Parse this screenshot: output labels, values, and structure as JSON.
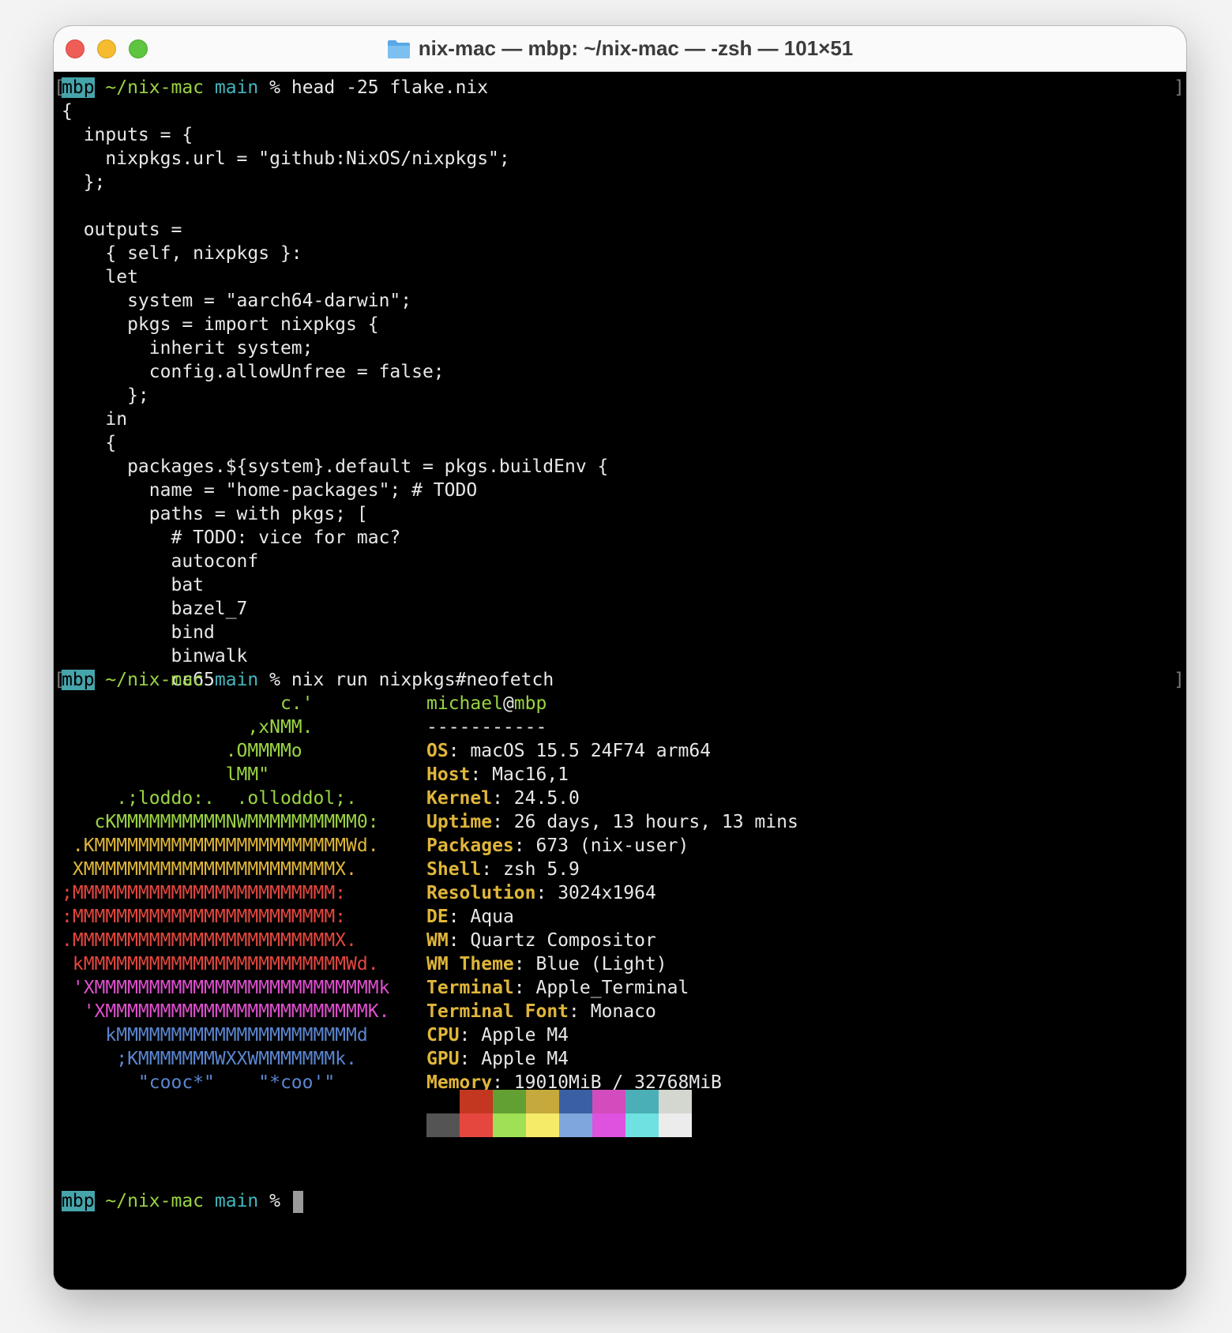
{
  "window": {
    "title": "nix-mac — mbp: ~/nix-mac — -zsh — 101×51",
    "folder_icon": "folder-icon"
  },
  "prompt": {
    "host": "mbp",
    "dir": "~/nix-mac",
    "branch": "main",
    "symbol": "%"
  },
  "commands": {
    "first": "head -25 flake.nix",
    "second": "nix run nixpkgs#neofetch"
  },
  "flake_lines": [
    "{",
    "  inputs = {",
    "    nixpkgs.url = \"github:NixOS/nixpkgs\";",
    "  };",
    "",
    "  outputs =",
    "    { self, nixpkgs }:",
    "    let",
    "      system = \"aarch64-darwin\";",
    "      pkgs = import nixpkgs {",
    "        inherit system;",
    "        config.allowUnfree = false;",
    "      };",
    "    in",
    "    {",
    "      packages.${system}.default = pkgs.buildEnv {",
    "        name = \"home-packages\"; # TODO",
    "        paths = with pkgs; [",
    "          # TODO: vice for mac?",
    "          autoconf",
    "          bat",
    "          bazel_7",
    "          bind",
    "          binwalk",
    "          cc65"
  ],
  "logo_lines": [
    {
      "text": "                    c.'",
      "color": "#9ad442"
    },
    {
      "text": "                 ,xNMM.",
      "color": "#9ad442"
    },
    {
      "text": "               .OMMMMo",
      "color": "#9ad442"
    },
    {
      "text": "               lMM\"",
      "color": "#9ad442"
    },
    {
      "text": "     .;loddo:.  .olloddol;.",
      "color": "#9ad442"
    },
    {
      "text": "   cKMMMMMMMMMMNWMMMMMMMMMM0:",
      "color": "#9ad442"
    },
    {
      "text": " .KMMMMMMMMMMMMMMMMMMMMMMMWd.",
      "color": "#e0b63a"
    },
    {
      "text": " XMMMMMMMMMMMMMMMMMMMMMMMX.",
      "color": "#e0b63a"
    },
    {
      "text": ";MMMMMMMMMMMMMMMMMMMMMMMM:",
      "color": "#e5473f"
    },
    {
      "text": ":MMMMMMMMMMMMMMMMMMMMMMMM:",
      "color": "#e5473f"
    },
    {
      "text": ".MMMMMMMMMMMMMMMMMMMMMMMMX.",
      "color": "#e5473f"
    },
    {
      "text": " kMMMMMMMMMMMMMMMMMMMMMMMMWd.",
      "color": "#e5473f"
    },
    {
      "text": " 'XMMMMMMMMMMMMMMMMMMMMMMMMMMk",
      "color": "#e04fcf"
    },
    {
      "text": "  'XMMMMMMMMMMMMMMMMMMMMMMMMK.",
      "color": "#e04fcf"
    },
    {
      "text": "    kMMMMMMMMMMMMMMMMMMMMMMd",
      "color": "#5b86d0"
    },
    {
      "text": "     ;KMMMMMMMWXXWMMMMMMMk.",
      "color": "#5b86d0"
    },
    {
      "text": "       \"cooc*\"    \"*coo'\"",
      "color": "#5b86d0"
    }
  ],
  "neofetch": {
    "user": "michael",
    "at": "@",
    "host": "mbp",
    "separator": "-----------",
    "fields": [
      {
        "key": "OS",
        "value": "macOS 15.5 24F74 arm64"
      },
      {
        "key": "Host",
        "value": "Mac16,1"
      },
      {
        "key": "Kernel",
        "value": "24.5.0"
      },
      {
        "key": "Uptime",
        "value": "26 days, 13 hours, 13 mins"
      },
      {
        "key": "Packages",
        "value": "673 (nix-user)"
      },
      {
        "key": "Shell",
        "value": "zsh 5.9"
      },
      {
        "key": "Resolution",
        "value": "3024x1964"
      },
      {
        "key": "DE",
        "value": "Aqua"
      },
      {
        "key": "WM",
        "value": "Quartz Compositor"
      },
      {
        "key": "WM Theme",
        "value": "Blue (Light)"
      },
      {
        "key": "Terminal",
        "value": "Apple_Terminal"
      },
      {
        "key": "Terminal Font",
        "value": "Monaco"
      },
      {
        "key": "CPU",
        "value": "Apple M4"
      },
      {
        "key": "GPU",
        "value": "Apple M4"
      },
      {
        "key": "Memory",
        "value": "19010MiB / 32768MiB"
      }
    ]
  },
  "palette": {
    "top": [
      "#000000",
      "#c33720",
      "#63a033",
      "#c5a93d",
      "#3b5fa3",
      "#d34cbe",
      "#4aafb6",
      "#d4d6d0"
    ],
    "bottom": [
      "#545454",
      "#e5473f",
      "#9fe054",
      "#f6ea69",
      "#80a7dd",
      "#dd52de",
      "#6fe1e0",
      "#ececec"
    ]
  }
}
